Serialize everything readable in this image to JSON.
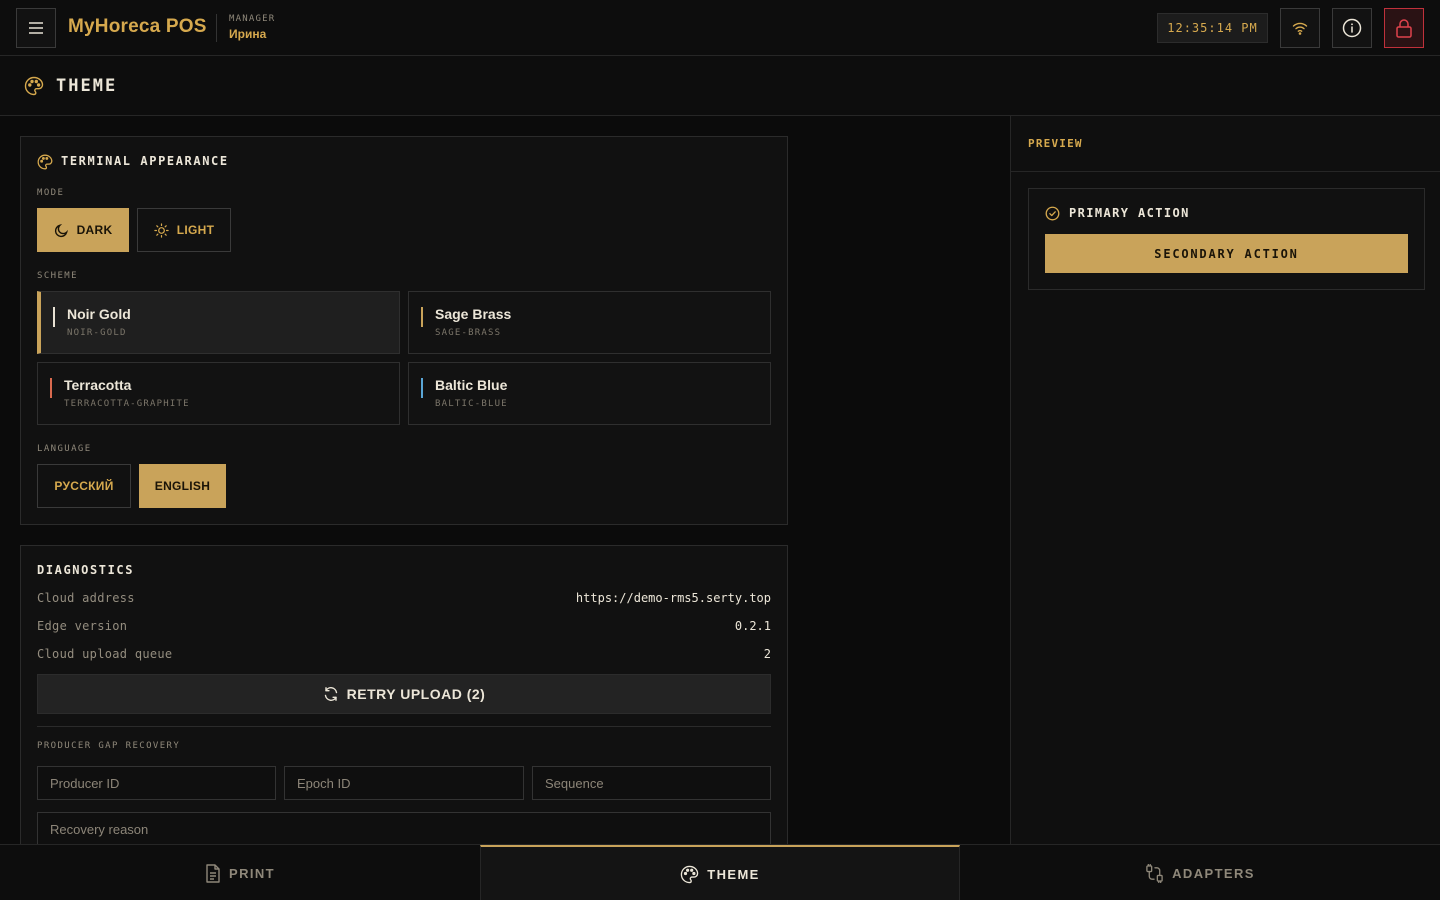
{
  "colors": {
    "accent": "#c9a35a",
    "brand": "#d6a94e",
    "danger": "#c0313b",
    "background": "#0b0b0b"
  },
  "header": {
    "brand": "MyHoreca POS",
    "role": "MANAGER",
    "user": "Ирина",
    "clock": "12:35:14 PM",
    "icons": [
      "menu-icon",
      "wifi-icon",
      "info-icon",
      "lock-icon"
    ]
  },
  "page": {
    "title": "THEME"
  },
  "appearance": {
    "title": "TERMINAL APPEARANCE",
    "mode_label": "MODE",
    "modes": [
      {
        "label": "DARK",
        "icon": "moon-icon",
        "active": true
      },
      {
        "label": "LIGHT",
        "icon": "sun-icon",
        "active": false
      }
    ],
    "scheme_label": "SCHEME",
    "schemes": [
      {
        "name": "Noir Gold",
        "id": "NOIR-GOLD",
        "swatch": "#e8e2d4",
        "active": true
      },
      {
        "name": "Sage Brass",
        "id": "SAGE-BRASS",
        "swatch": "#c9a35a",
        "active": false
      },
      {
        "name": "Terracotta",
        "id": "TERRACOTTA-GRAPHITE",
        "swatch": "#d96a4f",
        "active": false
      },
      {
        "name": "Baltic Blue",
        "id": "BALTIC-BLUE",
        "swatch": "#5aa6d6",
        "active": false
      }
    ],
    "language_label": "LANGUAGE",
    "languages": [
      {
        "label": "РУССКИЙ",
        "active": false
      },
      {
        "label": "ENGLISH",
        "active": true
      }
    ]
  },
  "diagnostics": {
    "title": "DIAGNOSTICS",
    "rows": [
      {
        "key": "Cloud address",
        "value": "https://demo-rms5.serty.top"
      },
      {
        "key": "Edge version",
        "value": "0.2.1"
      },
      {
        "key": "Cloud upload queue",
        "value": "2"
      }
    ],
    "retry_label": "RETRY UPLOAD (2)",
    "recovery_label": "PRODUCER GAP RECOVERY",
    "placeholders": {
      "producer": "Producer ID",
      "epoch": "Epoch ID",
      "sequence": "Sequence",
      "reason": "Recovery reason"
    }
  },
  "preview": {
    "label": "PREVIEW",
    "primary": "PRIMARY ACTION",
    "secondary": "SECONDARY ACTION"
  },
  "nav": {
    "tabs": [
      {
        "label": "PRINT",
        "icon": "document-icon",
        "active": false
      },
      {
        "label": "THEME",
        "icon": "palette-icon",
        "active": true
      },
      {
        "label": "ADAPTERS",
        "icon": "adapter-icon",
        "active": false
      }
    ]
  }
}
